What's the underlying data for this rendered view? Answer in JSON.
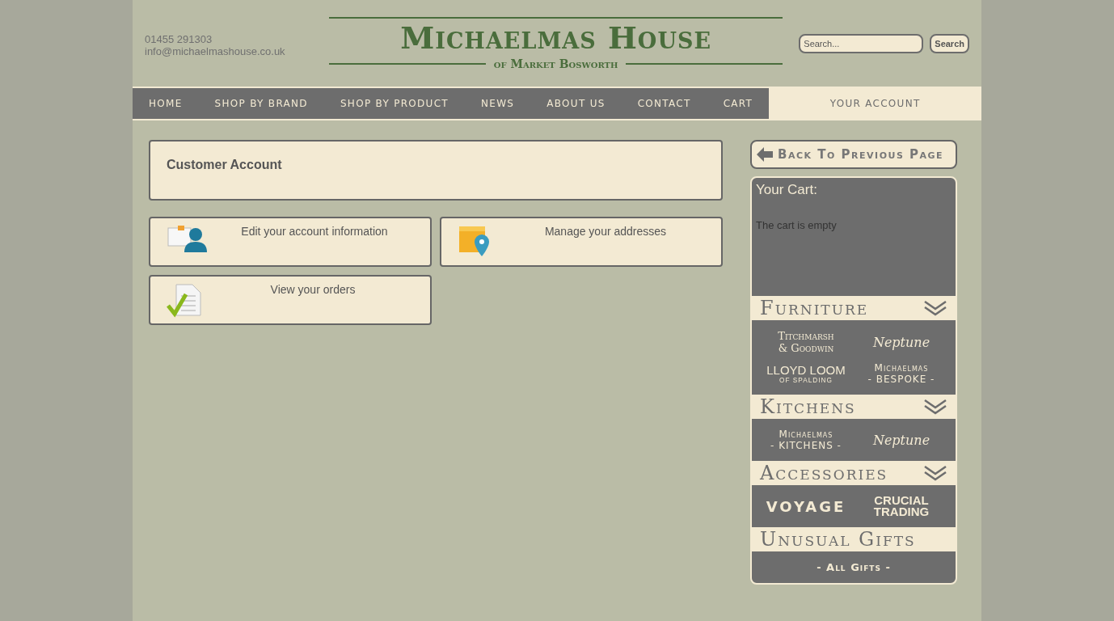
{
  "header": {
    "phone": "01455 291303",
    "email": "info@michaelmashouse.co.uk",
    "logo_title": "Michaelmas House",
    "logo_subtitle": "of Market Bosworth",
    "search": {
      "placeholder": "Search...",
      "button": "Search"
    }
  },
  "nav": [
    {
      "label": "HOME",
      "selected": false
    },
    {
      "label": "SHOP BY BRAND",
      "selected": false
    },
    {
      "label": "SHOP BY PRODUCT",
      "selected": false
    },
    {
      "label": "NEWS",
      "selected": false
    },
    {
      "label": "ABOUT US",
      "selected": false
    },
    {
      "label": "CONTACT",
      "selected": false
    },
    {
      "label": "CART",
      "selected": false
    },
    {
      "label": "YOUR ACCOUNT",
      "selected": true
    }
  ],
  "account": {
    "title": "Customer Account",
    "links": [
      {
        "kind": "profile",
        "label": "Edit your account information"
      },
      {
        "kind": "address",
        "label": "Manage your addresses"
      },
      {
        "kind": "orders",
        "label": "View your orders"
      }
    ]
  },
  "sidebar": {
    "back_button": "Back To Previous Page",
    "cart": {
      "title": "Your Cart:",
      "message": "The cart is empty"
    },
    "sections": [
      {
        "title": "Furniture",
        "has_menu": true,
        "brands": [
          {
            "kind": "serif",
            "lines": [
              "Titchmarsh",
              "& Goodwin"
            ]
          },
          {
            "kind": "script",
            "lines": [
              "Neptune"
            ]
          },
          {
            "kind": "thin",
            "lines": [
              "LLOYD LOOM",
              "OF SPALDING"
            ]
          },
          {
            "kind": "caps",
            "lines": [
              "Michaelmas",
              "- BESPOKE -"
            ]
          }
        ]
      },
      {
        "title": "Kitchens",
        "has_menu": true,
        "brands": [
          {
            "kind": "caps",
            "lines": [
              "Michaelmas",
              "- KITCHENS -"
            ]
          },
          {
            "kind": "script",
            "lines": [
              "Neptune"
            ]
          }
        ]
      },
      {
        "title": "Accessories",
        "has_menu": true,
        "brands": [
          {
            "kind": "wide",
            "lines": [
              "VOYAGE"
            ]
          },
          {
            "kind": "block",
            "lines": [
              "CRUCIAL",
              "TRADING"
            ]
          }
        ]
      },
      {
        "title": "Unusual Gifts",
        "has_menu": false,
        "brands": [
          {
            "kind": "single",
            "lines": [
              "- All Gifts -"
            ]
          }
        ]
      }
    ]
  }
}
